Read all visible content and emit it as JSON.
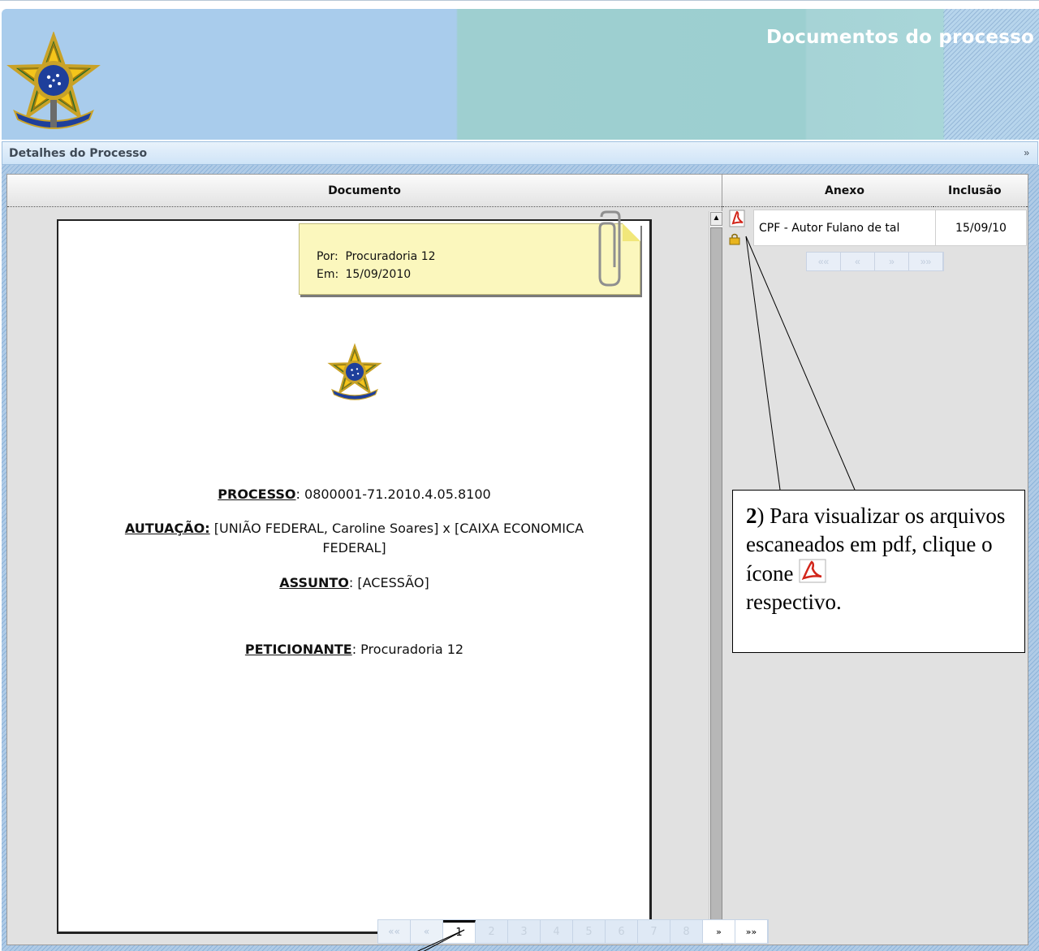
{
  "header": {
    "title": "Documentos do processo"
  },
  "breadcrumb": {
    "label": "Detalhes do Processo",
    "expand_glyph": "»"
  },
  "document_panel": {
    "column_header": "Documento",
    "note": {
      "por_label": "Por:",
      "por_value": "Procuradoria 12",
      "em_label": "Em:",
      "em_value": "15/09/2010"
    },
    "lines": {
      "processo_label": "PROCESSO",
      "processo_value": ": 0800001-71.2010.4.05.8100",
      "autuacao_label": "AUTUAÇÃO:",
      "autuacao_value_1": " [UNIÃO FEDERAL, Caroline Soares] x [CAIXA ECONOMICA",
      "autuacao_value_2": "FEDERAL]",
      "assunto_label": "ASSUNTO",
      "assunto_value": ": [ACESSÃO]",
      "peticionante_label": "PETICIONANTE",
      "peticionante_value": ": Procuradoria 12"
    },
    "pager": {
      "first": "««",
      "prev": "«",
      "pages": [
        "1",
        "2",
        "3",
        "4",
        "5",
        "6",
        "7",
        "8"
      ],
      "current_page": 1,
      "next": "»",
      "last": "»»"
    }
  },
  "attachments_panel": {
    "col_anexo": "Anexo",
    "col_inclusao": "Inclusão",
    "rows": [
      {
        "name": "CPF - Autor Fulano de tal",
        "date": "15/09/10",
        "icon": "pdf-icon",
        "badge_icon": "lock-icon"
      }
    ],
    "pager": {
      "first": "««",
      "prev": "«",
      "next": "»",
      "last": "»»"
    }
  },
  "callout": {
    "number": "2",
    "text_1": ") Para visualizar os arquivos escaneados em pdf, clique o ícone",
    "text_2": "respectivo."
  },
  "colors": {
    "banner_blue": "#a9ccec",
    "banner_teal": "#9ecfd0",
    "note_yellow": "#fbf7bd",
    "panel_gray": "#e1e1e1",
    "pdf_red": "#d2261b"
  }
}
